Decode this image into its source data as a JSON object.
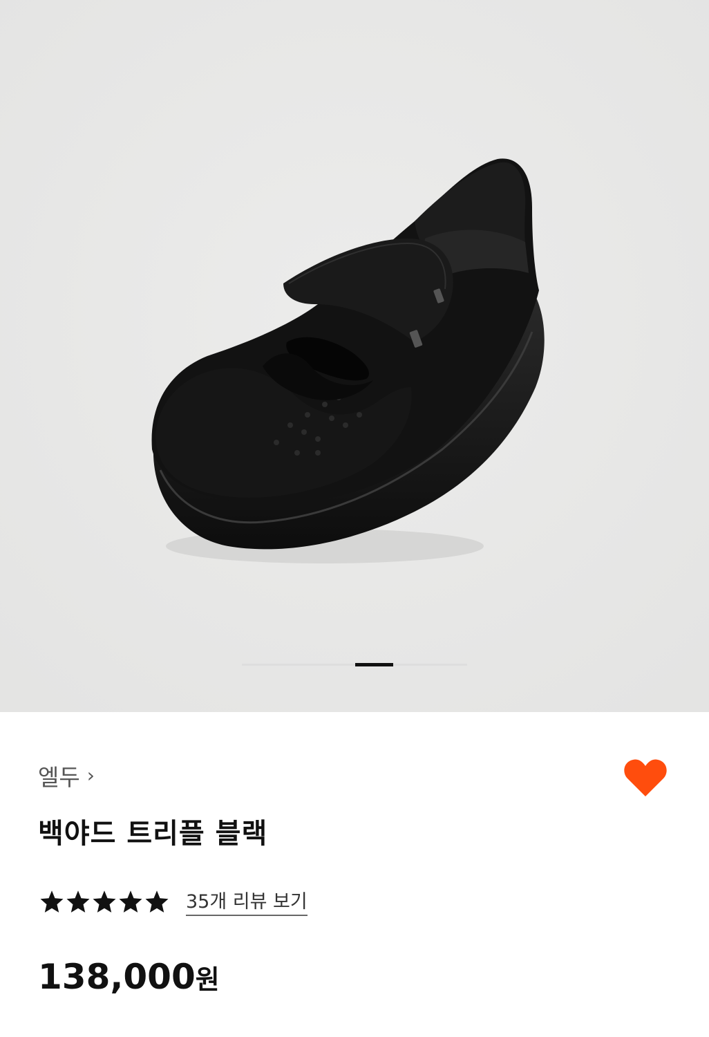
{
  "gallery": {
    "image_alt": "black suede velcro strap shoe",
    "slide_current": 2,
    "slide_total": 3
  },
  "product": {
    "brand": "엘두",
    "brand_chevron": "›",
    "title": "백야드 트리플 블랙",
    "rating": 5,
    "review_link": "35개 리뷰 보기",
    "price_amount": "138,000",
    "price_unit": "원",
    "favorite": true
  },
  "colors": {
    "gallery_bg": "#e9e9e8",
    "heart": "#ff4d0d",
    "star": "#111111"
  },
  "icons": {
    "favorite": "heart-icon",
    "brand_link": "chevron-right-icon",
    "rating": "star-icon"
  }
}
